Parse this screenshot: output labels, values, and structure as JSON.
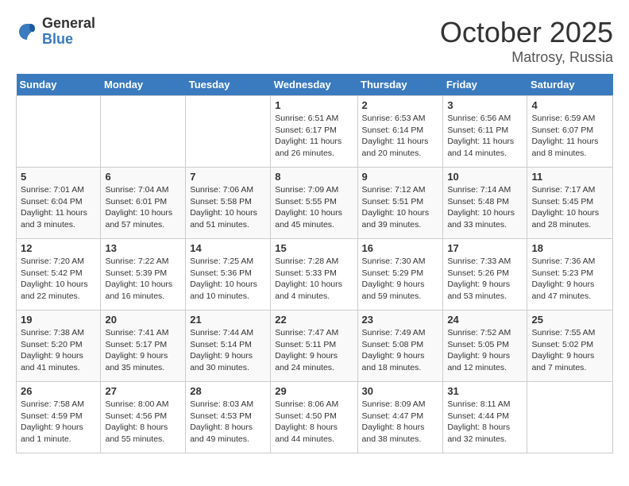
{
  "header": {
    "logo_general": "General",
    "logo_blue": "Blue",
    "month": "October 2025",
    "location": "Matrosy, Russia"
  },
  "days_of_week": [
    "Sunday",
    "Monday",
    "Tuesday",
    "Wednesday",
    "Thursday",
    "Friday",
    "Saturday"
  ],
  "weeks": [
    [
      {
        "day": "",
        "info": ""
      },
      {
        "day": "",
        "info": ""
      },
      {
        "day": "",
        "info": ""
      },
      {
        "day": "1",
        "info": "Sunrise: 6:51 AM\nSunset: 6:17 PM\nDaylight: 11 hours\nand 26 minutes."
      },
      {
        "day": "2",
        "info": "Sunrise: 6:53 AM\nSunset: 6:14 PM\nDaylight: 11 hours\nand 20 minutes."
      },
      {
        "day": "3",
        "info": "Sunrise: 6:56 AM\nSunset: 6:11 PM\nDaylight: 11 hours\nand 14 minutes."
      },
      {
        "day": "4",
        "info": "Sunrise: 6:59 AM\nSunset: 6:07 PM\nDaylight: 11 hours\nand 8 minutes."
      }
    ],
    [
      {
        "day": "5",
        "info": "Sunrise: 7:01 AM\nSunset: 6:04 PM\nDaylight: 11 hours\nand 3 minutes."
      },
      {
        "day": "6",
        "info": "Sunrise: 7:04 AM\nSunset: 6:01 PM\nDaylight: 10 hours\nand 57 minutes."
      },
      {
        "day": "7",
        "info": "Sunrise: 7:06 AM\nSunset: 5:58 PM\nDaylight: 10 hours\nand 51 minutes."
      },
      {
        "day": "8",
        "info": "Sunrise: 7:09 AM\nSunset: 5:55 PM\nDaylight: 10 hours\nand 45 minutes."
      },
      {
        "day": "9",
        "info": "Sunrise: 7:12 AM\nSunset: 5:51 PM\nDaylight: 10 hours\nand 39 minutes."
      },
      {
        "day": "10",
        "info": "Sunrise: 7:14 AM\nSunset: 5:48 PM\nDaylight: 10 hours\nand 33 minutes."
      },
      {
        "day": "11",
        "info": "Sunrise: 7:17 AM\nSunset: 5:45 PM\nDaylight: 10 hours\nand 28 minutes."
      }
    ],
    [
      {
        "day": "12",
        "info": "Sunrise: 7:20 AM\nSunset: 5:42 PM\nDaylight: 10 hours\nand 22 minutes."
      },
      {
        "day": "13",
        "info": "Sunrise: 7:22 AM\nSunset: 5:39 PM\nDaylight: 10 hours\nand 16 minutes."
      },
      {
        "day": "14",
        "info": "Sunrise: 7:25 AM\nSunset: 5:36 PM\nDaylight: 10 hours\nand 10 minutes."
      },
      {
        "day": "15",
        "info": "Sunrise: 7:28 AM\nSunset: 5:33 PM\nDaylight: 10 hours\nand 4 minutes."
      },
      {
        "day": "16",
        "info": "Sunrise: 7:30 AM\nSunset: 5:29 PM\nDaylight: 9 hours\nand 59 minutes."
      },
      {
        "day": "17",
        "info": "Sunrise: 7:33 AM\nSunset: 5:26 PM\nDaylight: 9 hours\nand 53 minutes."
      },
      {
        "day": "18",
        "info": "Sunrise: 7:36 AM\nSunset: 5:23 PM\nDaylight: 9 hours\nand 47 minutes."
      }
    ],
    [
      {
        "day": "19",
        "info": "Sunrise: 7:38 AM\nSunset: 5:20 PM\nDaylight: 9 hours\nand 41 minutes."
      },
      {
        "day": "20",
        "info": "Sunrise: 7:41 AM\nSunset: 5:17 PM\nDaylight: 9 hours\nand 35 minutes."
      },
      {
        "day": "21",
        "info": "Sunrise: 7:44 AM\nSunset: 5:14 PM\nDaylight: 9 hours\nand 30 minutes."
      },
      {
        "day": "22",
        "info": "Sunrise: 7:47 AM\nSunset: 5:11 PM\nDaylight: 9 hours\nand 24 minutes."
      },
      {
        "day": "23",
        "info": "Sunrise: 7:49 AM\nSunset: 5:08 PM\nDaylight: 9 hours\nand 18 minutes."
      },
      {
        "day": "24",
        "info": "Sunrise: 7:52 AM\nSunset: 5:05 PM\nDaylight: 9 hours\nand 12 minutes."
      },
      {
        "day": "25",
        "info": "Sunrise: 7:55 AM\nSunset: 5:02 PM\nDaylight: 9 hours\nand 7 minutes."
      }
    ],
    [
      {
        "day": "26",
        "info": "Sunrise: 7:58 AM\nSunset: 4:59 PM\nDaylight: 9 hours\nand 1 minute."
      },
      {
        "day": "27",
        "info": "Sunrise: 8:00 AM\nSunset: 4:56 PM\nDaylight: 8 hours\nand 55 minutes."
      },
      {
        "day": "28",
        "info": "Sunrise: 8:03 AM\nSunset: 4:53 PM\nDaylight: 8 hours\nand 49 minutes."
      },
      {
        "day": "29",
        "info": "Sunrise: 8:06 AM\nSunset: 4:50 PM\nDaylight: 8 hours\nand 44 minutes."
      },
      {
        "day": "30",
        "info": "Sunrise: 8:09 AM\nSunset: 4:47 PM\nDaylight: 8 hours\nand 38 minutes."
      },
      {
        "day": "31",
        "info": "Sunrise: 8:11 AM\nSunset: 4:44 PM\nDaylight: 8 hours\nand 32 minutes."
      },
      {
        "day": "",
        "info": ""
      }
    ]
  ]
}
